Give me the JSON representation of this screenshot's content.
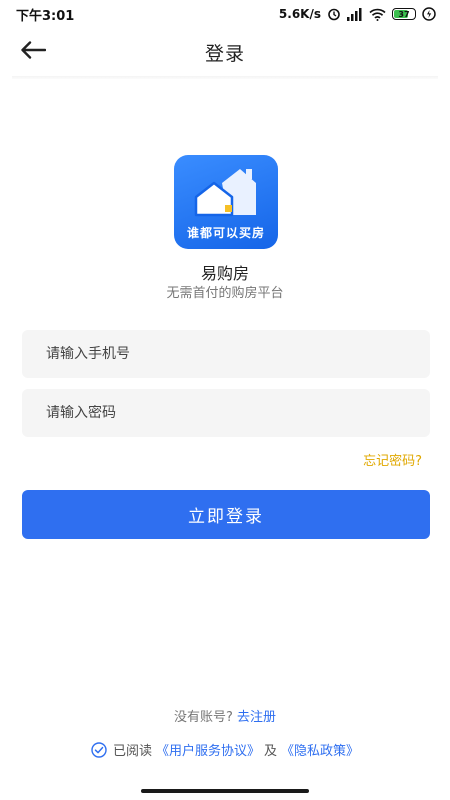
{
  "status_bar": {
    "time": "下午3:01",
    "network_speed": "5.6K/s",
    "battery": "37",
    "icons": [
      "alarm-icon",
      "signal-icon",
      "wifi-icon",
      "battery-icon",
      "charging-icon"
    ]
  },
  "nav": {
    "back_icon": "arrow-left-icon",
    "title": "登录"
  },
  "brand": {
    "logo_slogan": "谁都可以买房",
    "app_name": "易购房",
    "tagline": "无需首付的购房平台",
    "logo_color": "#1f74f0"
  },
  "form": {
    "phone_placeholder": "请输入手机号",
    "phone_value": "",
    "password_placeholder": "请输入密码",
    "password_value": "",
    "forgot_label": "忘记密码?",
    "login_label": "立即登录"
  },
  "register": {
    "prompt": "没有账号?",
    "link": "去注册"
  },
  "agreement": {
    "checked": true,
    "prefix": "已阅读",
    "user_agreement": "《用户服务协议》",
    "and": "及",
    "privacy_policy": "《隐私政策》"
  },
  "colors": {
    "primary": "#2f6ff0",
    "forgot": "#e0a800",
    "input_bg": "#f5f5f5"
  }
}
